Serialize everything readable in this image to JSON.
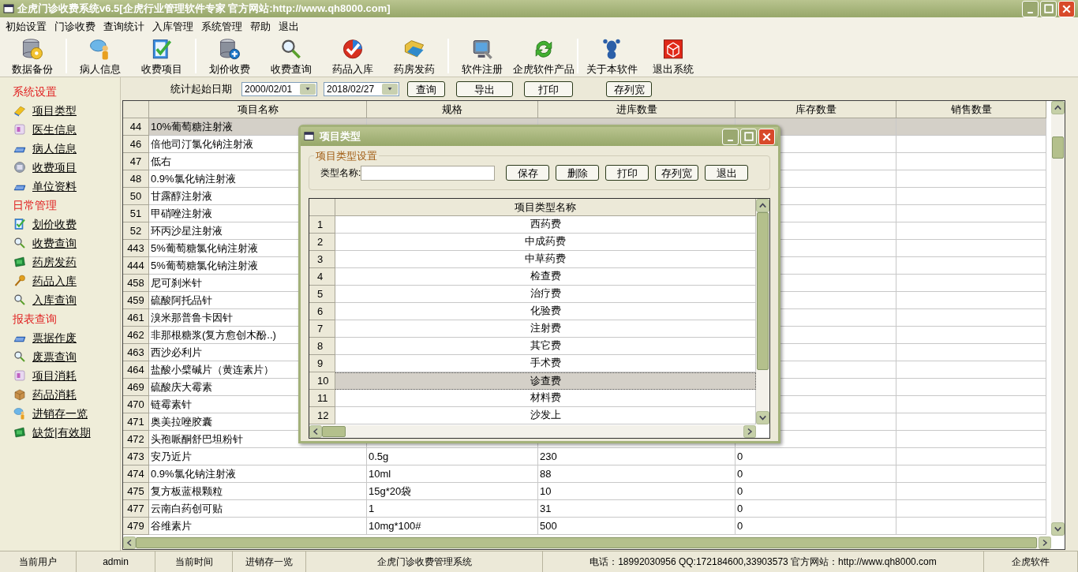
{
  "window": {
    "title": "企虎门诊收费系统v6.5[企虎行业管理软件专家 官方网站:http://www.qh8000.com]"
  },
  "menu": [
    "初始设置",
    "门诊收费",
    "查询统计",
    "入库管理",
    "系统管理",
    "帮助",
    "退出"
  ],
  "toolbar": [
    [
      "数据备份"
    ],
    [
      "病人信息",
      "收费项目"
    ],
    [
      "划价收费",
      "收费查询",
      "药品入库",
      "药房发药"
    ],
    [
      "软件注册",
      "企虎软件产品"
    ],
    [
      "关于本软件",
      "退出系统"
    ]
  ],
  "sidebar": [
    {
      "title": "系统设置",
      "items": [
        "项目类型",
        "医生信息",
        "病人信息",
        "收费项目",
        "单位资料"
      ]
    },
    {
      "title": "日常管理",
      "items": [
        "划价收费",
        "收费查询",
        "药房发药",
        "药品入库",
        "入库查询"
      ]
    },
    {
      "title": "报表查询",
      "items": [
        "票据作废",
        "废票查询",
        "项目消耗",
        "药品消耗",
        "进销存一览",
        "缺货|有效期"
      ]
    }
  ],
  "filter": {
    "label": "统计起始日期",
    "start_date": "2000/02/01",
    "end_date": "2018/02/27",
    "buttons": [
      "查询",
      "导出",
      "打印",
      "存列宽"
    ]
  },
  "table": {
    "columns": [
      "",
      "项目名称",
      "规格",
      "进库数量",
      "库存数量",
      "销售数量"
    ],
    "rows": [
      {
        "cells": [
          "44",
          "10%葡萄糖注射液"
        ],
        "selected": true
      },
      {
        "cells": [
          "46",
          "倍他司汀氯化钠注射液"
        ],
        "selected": false
      },
      {
        "cells": [
          "47",
          "低右"
        ],
        "selected": false
      },
      {
        "cells": [
          "48",
          "0.9%氯化钠注射液"
        ],
        "selected": false
      },
      {
        "cells": [
          "50",
          "甘露醇注射液"
        ],
        "selected": false
      },
      {
        "cells": [
          "51",
          "甲硝唑注射液"
        ],
        "selected": false
      },
      {
        "cells": [
          "52",
          "环丙沙星注射液"
        ],
        "selected": false
      },
      {
        "cells": [
          "443",
          "5%葡萄糖氯化钠注射液"
        ],
        "selected": false
      },
      {
        "cells": [
          "444",
          "5%葡萄糖氯化钠注射液"
        ],
        "selected": false
      },
      {
        "cells": [
          "458",
          "尼可刹米针"
        ],
        "selected": false
      },
      {
        "cells": [
          "459",
          "硫酸阿托品针"
        ],
        "selected": false
      },
      {
        "cells": [
          "461",
          "溴米那普鲁卡因针"
        ],
        "selected": false
      },
      {
        "cells": [
          "462",
          "非那根糖浆(复方愈创木酚..)"
        ],
        "selected": false
      },
      {
        "cells": [
          "463",
          "西沙必利片"
        ],
        "selected": false
      },
      {
        "cells": [
          "464",
          "盐酸小檗碱片（黄连素片）"
        ],
        "selected": false
      },
      {
        "cells": [
          "469",
          "硫酸庆大霉素"
        ],
        "selected": false
      },
      {
        "cells": [
          "470",
          "链霉素针"
        ],
        "selected": false
      },
      {
        "cells": [
          "471",
          "奥美拉唑胶囊"
        ],
        "selected": false
      },
      {
        "cells": [
          "472",
          "头孢哌酮舒巴坦粉针"
        ],
        "selected": false
      },
      {
        "cells": [
          "473",
          "安乃近片",
          "0.5g",
          "230",
          "0"
        ],
        "selected": false
      },
      {
        "cells": [
          "474",
          "0.9%氯化钠注射液",
          "10ml",
          "88",
          "0"
        ],
        "selected": false
      },
      {
        "cells": [
          "475",
          "复方板蓝根颗粒",
          "15g*20袋",
          "10",
          "0"
        ],
        "selected": false
      },
      {
        "cells": [
          "477",
          "云南白药创可贴",
          "1",
          "31",
          "0"
        ],
        "selected": false
      },
      {
        "cells": [
          "479",
          "谷维素片",
          "10mg*100#",
          "500",
          "0"
        ],
        "selected": false
      }
    ]
  },
  "dialog": {
    "title": "项目类型",
    "group_title": "项目类型设置",
    "field_label": "类型名称:",
    "buttons": [
      "保存",
      "删除",
      "打印",
      "存列宽",
      "退出"
    ],
    "columns": [
      "",
      "项目类型名称"
    ],
    "rows": [
      {
        "cells": [
          "1",
          "西药费"
        ],
        "selected": false
      },
      {
        "cells": [
          "2",
          "中成药费"
        ],
        "selected": false
      },
      {
        "cells": [
          "3",
          "中草药费"
        ],
        "selected": false
      },
      {
        "cells": [
          "4",
          "检查费"
        ],
        "selected": false
      },
      {
        "cells": [
          "5",
          "治疗费"
        ],
        "selected": false
      },
      {
        "cells": [
          "6",
          "化验费"
        ],
        "selected": false
      },
      {
        "cells": [
          "7",
          "注射费"
        ],
        "selected": false
      },
      {
        "cells": [
          "8",
          "其它费"
        ],
        "selected": false
      },
      {
        "cells": [
          "9",
          "手术费"
        ],
        "selected": false
      },
      {
        "cells": [
          "10",
          "诊查费"
        ],
        "selected": true
      },
      {
        "cells": [
          "11",
          "材料费"
        ],
        "selected": false
      },
      {
        "cells": [
          "12",
          "沙发上"
        ],
        "selected": false
      }
    ]
  },
  "status_bar": [
    "当前用户",
    "admin",
    "当前时间",
    "进销存一览",
    "企虎门诊收费管理系统",
    "电话：18992030956 QQ:172184600,33903573  官方网站：http://www.qh8000.com",
    "企虎软件"
  ]
}
